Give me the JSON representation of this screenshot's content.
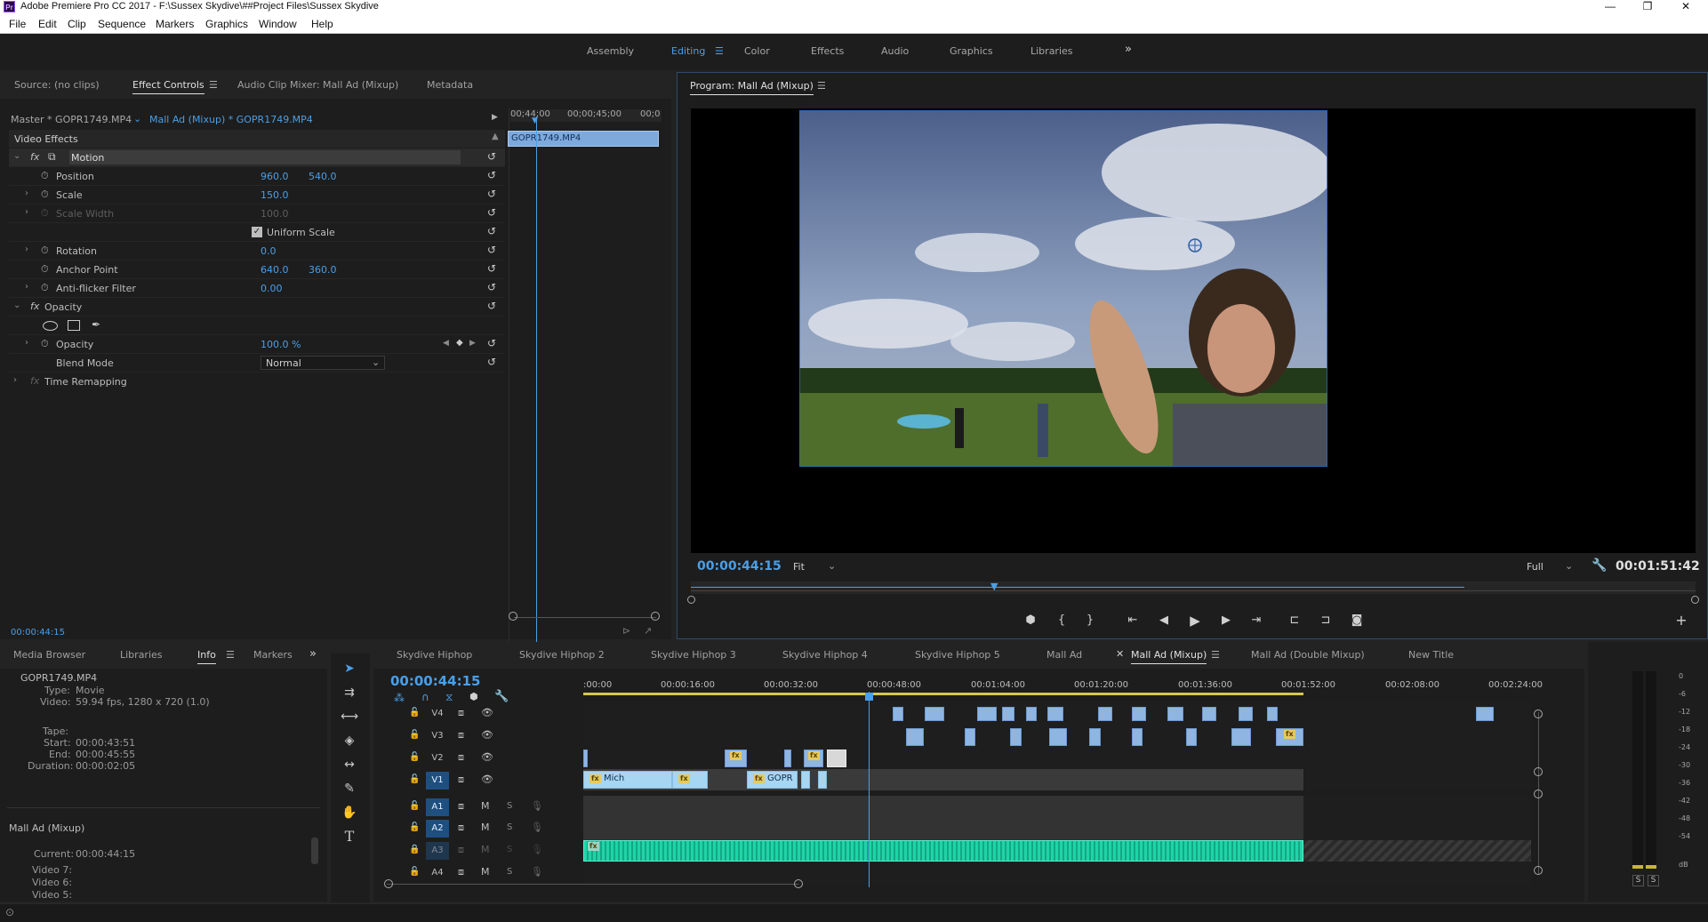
{
  "app": {
    "title": "Adobe Premiere Pro CC 2017 - F:\\Sussex Skydive\\##Project Files\\Sussex Skydive",
    "logo": "Pr",
    "menu": [
      "File",
      "Edit",
      "Clip",
      "Sequence",
      "Markers",
      "Graphics",
      "Window",
      "Help"
    ],
    "window_controls": [
      "—",
      "❐",
      "✕"
    ]
  },
  "workspaces": {
    "items": [
      "Assembly",
      "Editing",
      "Color",
      "Effects",
      "Audio",
      "Graphics",
      "Libraries"
    ],
    "active": "Editing",
    "overflow": "»"
  },
  "source_panel": {
    "tabs": [
      "Source: (no clips)",
      "Effect Controls",
      "Audio Clip Mixer: Mall Ad (Mixup)",
      "Metadata"
    ],
    "active_tab": "Effect Controls",
    "master_label": "Master * GOPR1749.MP4",
    "sequence_label": "Mall Ad (Mixup) * GOPR1749.MP4",
    "section": "Video Effects",
    "motion": {
      "name": "Motion",
      "position_label": "Position",
      "position_x": "960.0",
      "position_y": "540.0",
      "scale_label": "Scale",
      "scale": "150.0",
      "scale_width_label": "Scale Width",
      "scale_width": "100.0",
      "uniform_scale_label": "Uniform Scale",
      "rotation_label": "Rotation",
      "rotation": "0.0",
      "anchor_label": "Anchor Point",
      "anchor_x": "640.0",
      "anchor_y": "360.0",
      "antiflicker_label": "Anti-flicker Filter",
      "antiflicker": "0.00"
    },
    "opacity": {
      "name": "Opacity",
      "opacity_label": "Opacity",
      "opacity": "100.0 %",
      "blend_label": "Blend Mode",
      "blend": "Normal"
    },
    "time_remapping": "Time Remapping",
    "mini_timeline": {
      "ticks": [
        "00;44;00",
        "00;00;45;00",
        "00;0"
      ],
      "clip": "GOPR1749.MP4"
    },
    "timecode": "00:00:44:15"
  },
  "program": {
    "title": "Program: Mall Ad (Mixup)",
    "timecode": "00:00:44:15",
    "fit": "Fit",
    "quality": "Full",
    "duration": "00:01:51:42"
  },
  "project_panel": {
    "tabs": [
      "Media Browser",
      "Libraries",
      "Info",
      "Markers"
    ],
    "active_tab": "Info",
    "info": {
      "filename": "GOPR1749.MP4",
      "type_label": "Type:",
      "type": "Movie",
      "video_label": "Video:",
      "video": "59.94 fps, 1280 x 720 (1.0)",
      "tape_label": "Tape:",
      "start_label": "Start:",
      "start": "00:00:43:51",
      "end_label": "End:",
      "end": "00:00:45:55",
      "duration_label": "Duration:",
      "duration": "00:00:02:05"
    },
    "sequence": {
      "name": "Mall Ad (Mixup)",
      "current_label": "Current:",
      "current": "00:00:44:15",
      "tracks": [
        "Video 7:",
        "Video 6:",
        "Video 5:"
      ]
    }
  },
  "timeline": {
    "tabs": [
      "Skydive Hiphop",
      "Skydive Hiphop 2",
      "Skydive Hiphop 3",
      "Skydive Hiphop 4",
      "Skydive Hiphop 5",
      "Mall Ad",
      "Mall Ad (Mixup)",
      "Mall Ad (Double Mixup)",
      "New Title"
    ],
    "active_tab": "Mall Ad (Mixup)",
    "timecode": "00:00:44:15",
    "ruler": [
      ":00:00",
      "00:00:16:00",
      "00:00:32:00",
      "00:00:48:00",
      "00:01:04:00",
      "00:01:20:00",
      "00:01:36:00",
      "00:01:52:00",
      "00:02:08:00",
      "00:02:24:00"
    ],
    "video_tracks": [
      "V4",
      "V3",
      "V2",
      "V1"
    ],
    "audio_tracks": [
      "A1",
      "A2",
      "A3",
      "A4"
    ],
    "clip_labels": {
      "v1_a": "Mich",
      "v1_b": "GOPR",
      "fx": "fx"
    },
    "mute": "M",
    "solo": "S"
  },
  "meter": {
    "scale": [
      "0",
      "-6",
      "-12",
      "-18",
      "-24",
      "-30",
      "-36",
      "-42",
      "-48",
      "-54",
      "dB"
    ],
    "solo_buttons": [
      "S",
      "S"
    ]
  },
  "colors": {
    "accent": "#4a9fe8",
    "panel": "#1d1d1d",
    "audio_clip": "#1fd4a8",
    "video_clip": "#8fb6e3"
  }
}
